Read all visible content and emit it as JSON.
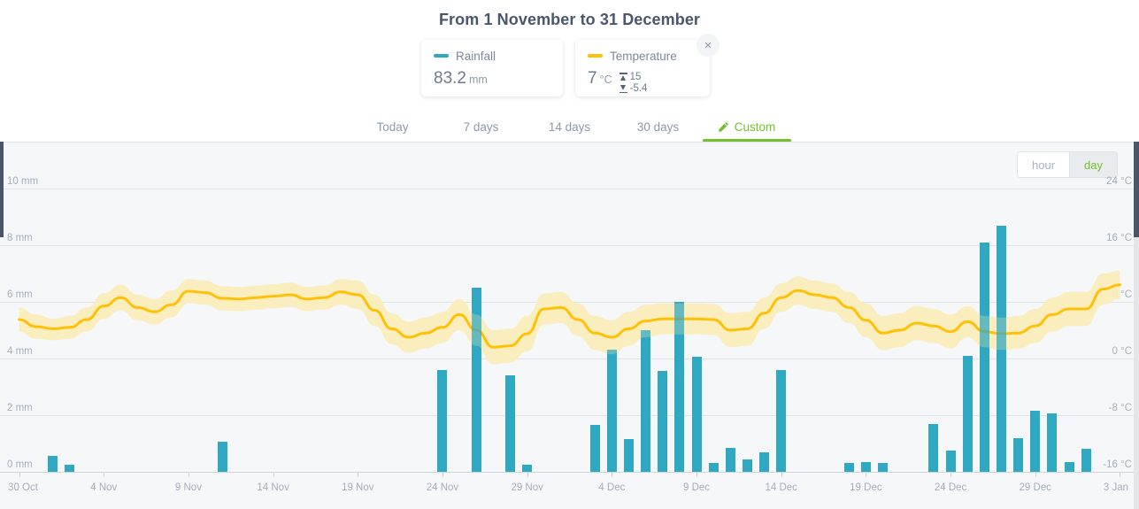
{
  "header": {
    "title": "From 1 November to 31 December",
    "close_label": "×"
  },
  "cards": {
    "rainfall": {
      "legend_label": "Rainfall",
      "value": "83.2",
      "unit": "mm",
      "color": "#2fa8c0"
    },
    "temperature": {
      "legend_label": "Temperature",
      "value": "7",
      "unit": "°C",
      "max": "15",
      "min": "-5.4",
      "color": "#ffc107"
    }
  },
  "tabs": [
    {
      "label": "Today",
      "active": false,
      "icon": ""
    },
    {
      "label": "7 days",
      "active": false,
      "icon": ""
    },
    {
      "label": "14 days",
      "active": false,
      "icon": ""
    },
    {
      "label": "30 days",
      "active": false,
      "icon": ""
    },
    {
      "label": "Custom",
      "active": true,
      "icon": "pencil-icon"
    }
  ],
  "granularity": {
    "options": [
      "hour",
      "day"
    ],
    "selected": "day"
  },
  "chart_data": {
    "type": "bar",
    "title": "From 1 November to 31 December",
    "xlabel": "",
    "ylabel": "Rainfall",
    "y2label": "Temperature",
    "grid": true,
    "legend_position": "top",
    "ylim": [
      0,
      10
    ],
    "y2lim": [
      -16,
      24
    ],
    "y_ticks": [
      "0 mm",
      "2 mm",
      "4 mm",
      "6 mm",
      "8 mm",
      "10 mm"
    ],
    "y_tick_values": [
      0,
      2,
      4,
      6,
      8,
      10
    ],
    "y2_ticks": [
      "-16 °C",
      "-8 °C",
      "0 °C",
      "8 °C",
      "16 °C",
      "24 °C"
    ],
    "y2_tick_values": [
      -16,
      -8,
      0,
      8,
      16,
      24
    ],
    "x_ticks": [
      "30 Oct",
      "4 Nov",
      "9 Nov",
      "14 Nov",
      "19 Nov",
      "24 Nov",
      "29 Nov",
      "4 Dec",
      "9 Dec",
      "14 Dec",
      "19 Dec",
      "24 Dec",
      "29 Dec",
      "3 Jan"
    ],
    "x_tick_index": [
      0,
      5,
      10,
      15,
      20,
      25,
      30,
      35,
      40,
      45,
      50,
      55,
      60,
      65
    ],
    "series": [
      {
        "name": "Rainfall",
        "unit": "mm",
        "type": "bar",
        "color": "#2fa8c0",
        "values": [
          0,
          0,
          0.55,
          0.25,
          0,
          0,
          0,
          0,
          0,
          0,
          0,
          0,
          1.05,
          0,
          0,
          0,
          0,
          0,
          0,
          0,
          0,
          0,
          0,
          0,
          0,
          3.6,
          0,
          6.5,
          0,
          3.4,
          0.25,
          0,
          0,
          0,
          1.65,
          4.3,
          1.15,
          5.0,
          3.55,
          6.0,
          4.05,
          0.3,
          0.85,
          0.45,
          0.7,
          3.6,
          0,
          0,
          0,
          0.3,
          0.35,
          0.3,
          0,
          0,
          1.7,
          0.75,
          4.1,
          8.1,
          8.7,
          1.2,
          2.15,
          2.05,
          0.35,
          0.8,
          0,
          0
        ]
      },
      {
        "name": "Temperature",
        "unit": "°C",
        "type": "line",
        "color": "#ffc107",
        "band_color": "#faecbb",
        "values": [
          5.5,
          4.5,
          4.2,
          4.4,
          5.5,
          7.4,
          8.6,
          7.2,
          6.6,
          7.6,
          9.5,
          9.3,
          8.5,
          8.4,
          8.6,
          8.8,
          9.0,
          8.4,
          8.6,
          9.4,
          9.0,
          6.8,
          4.2,
          3.0,
          3.6,
          4.4,
          6.2,
          4.0,
          1.6,
          1.8,
          3.5,
          7.0,
          7.2,
          5.5,
          3.6,
          3.0,
          4.2,
          5.3,
          5.6,
          5.6,
          5.6,
          5.5,
          4.0,
          4.2,
          6.4,
          8.6,
          9.6,
          9.0,
          8.6,
          7.2,
          5.4,
          3.6,
          4.0,
          5.0,
          4.6,
          3.8,
          5.2,
          3.8,
          3.5,
          3.6,
          4.6,
          6.2,
          7.0,
          7.0,
          9.8,
          10.4
        ],
        "band_upper": [
          7.2,
          6.2,
          5.6,
          6.0,
          7.2,
          9.2,
          10.4,
          9.0,
          8.4,
          9.6,
          11.2,
          11.0,
          10.2,
          10.1,
          10.3,
          10.5,
          10.7,
          10.1,
          10.3,
          11.2,
          11.0,
          9.0,
          6.4,
          5.2,
          5.8,
          6.6,
          8.4,
          6.2,
          4.0,
          4.2,
          6.0,
          9.2,
          9.4,
          7.8,
          6.0,
          5.4,
          6.6,
          7.6,
          7.8,
          7.8,
          7.8,
          7.7,
          6.4,
          6.6,
          8.6,
          10.6,
          11.6,
          11.0,
          10.6,
          9.4,
          7.8,
          6.0,
          6.4,
          7.4,
          7.0,
          6.2,
          7.4,
          6.0,
          5.8,
          6.0,
          7.0,
          8.6,
          9.4,
          9.4,
          12.0,
          12.4
        ],
        "band_lower": [
          3.8,
          2.8,
          2.6,
          2.8,
          3.8,
          5.6,
          6.8,
          5.4,
          4.8,
          5.8,
          7.8,
          7.6,
          6.8,
          6.7,
          6.9,
          7.1,
          7.3,
          6.7,
          6.9,
          7.6,
          7.0,
          4.6,
          2.0,
          0.8,
          1.4,
          2.2,
          4.0,
          1.8,
          -0.8,
          -0.6,
          1.0,
          4.8,
          5.0,
          3.2,
          1.2,
          0.6,
          1.8,
          3.0,
          3.4,
          3.4,
          3.4,
          3.3,
          1.6,
          1.8,
          4.2,
          6.6,
          7.6,
          7.0,
          6.6,
          5.0,
          3.0,
          1.2,
          1.6,
          2.6,
          2.2,
          1.4,
          3.0,
          1.6,
          1.2,
          1.4,
          2.2,
          3.8,
          4.6,
          4.6,
          7.6,
          8.4
        ]
      }
    ]
  }
}
